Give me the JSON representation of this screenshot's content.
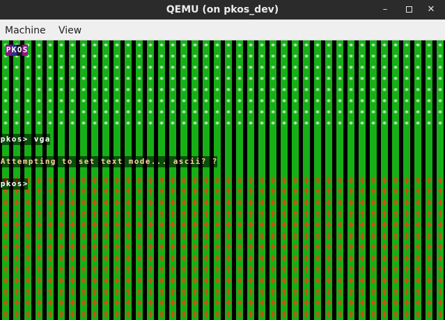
{
  "window": {
    "title": "QEMU (on pkos_dev)",
    "controls": {
      "minimize": "–",
      "close": "✕"
    }
  },
  "menu": {
    "items": [
      "Machine",
      "View"
    ]
  },
  "console": {
    "colors": {
      "green": "#16b016",
      "pattern_light": "#d8f8d8",
      "arrow": "#b85a10"
    },
    "lines": [
      {
        "text": "PKOS",
        "row": 0,
        "start": 1,
        "colors": [
          [
            "#ffffff",
            "#7a1a7a"
          ],
          [
            "#ffffff",
            "#2e2e8a"
          ],
          [
            "#ffffff",
            "#1a1a1a"
          ],
          [
            "#ffffff",
            "#8a1a8a"
          ]
        ]
      },
      {
        "text": "pkos> vga",
        "row": 8,
        "start": 0,
        "fg": "#ffffff"
      },
      {
        "text": "Attempting to set text mode... ascii? ?",
        "row": 10,
        "start": 0,
        "fg": "#ffd0a0"
      },
      {
        "text": "pkos>",
        "row": 12,
        "start": 0,
        "fg": "#ffffff"
      }
    ]
  }
}
